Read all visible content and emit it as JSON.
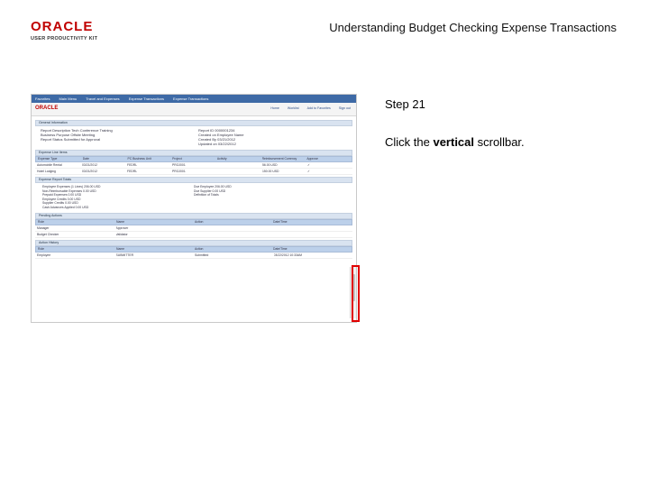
{
  "logo": {
    "primary": "ORACLE",
    "secondary": "USER PRODUCTIVITY KIT"
  },
  "header": {
    "title": "Understanding Budget Checking Expense Transactions"
  },
  "step": {
    "label": "Step 21"
  },
  "instruction": {
    "before": "Click the ",
    "bold": "vertical",
    "after": " scrollbar."
  },
  "colors": {
    "highlight": "#e00000",
    "brand_red": "#c00000",
    "nav_blue": "#3e6aa6"
  },
  "screenshot": {
    "brand": "ORACLE",
    "nav": [
      "Favorites",
      "Main Menu",
      "Travel and Expenses",
      "Expense Transactions",
      "Expense Transactions"
    ],
    "toplinks": [
      "Home",
      "Worklist",
      "Add to Favorites",
      "Sign out"
    ],
    "sections": {
      "general": "General Information",
      "lines": "Expense Line Items",
      "totals": "Expense Report Totals",
      "approvals": "Pending Actions",
      "history": "Action History"
    },
    "general_rows": [
      {
        "label": "Report Description",
        "value": "Tech Conference Training"
      },
      {
        "label": "Business Purpose",
        "value": "Offsite Meeting"
      },
      {
        "label": "Report Status",
        "value": "Submitted for Approval"
      }
    ],
    "general_rows_right": [
      {
        "label": "Report ID",
        "value": "0000001234"
      },
      {
        "label": "Created on",
        "value": "Employee Name"
      },
      {
        "label": "Created By",
        "value": "03/21/2012"
      },
      {
        "label": "Updated on",
        "value": "03/22/2012"
      }
    ],
    "line_columns": [
      "Expense Type",
      "Date",
      "PC Business Unit",
      "Project",
      "Activity",
      "Reimbursement Currency",
      "Approve"
    ],
    "line_rows": [
      [
        "Automobile Rental",
        "03/21/2012",
        "FEDRL",
        "PROJ001",
        "",
        "56.00 USD",
        "✓"
      ],
      [
        "Hotel Lodging",
        "03/21/2012",
        "FEDRL",
        "PROJ001",
        "",
        "150.00 USD",
        "✓"
      ]
    ],
    "totals_left": [
      "Employee Expenses (1 Lines) 206.00 USD",
      "Non-Reimbursable Expenses 0.00 USD",
      "Prepaid Expenses 0.00 USD",
      "Employee Credits 0.00 USD",
      "Supplier Credits 0.00 USD",
      "Cash Advances Applied 0.00 USD"
    ],
    "totals_right": [
      "Due Employee 206.00 USD",
      "Due Supplier 0.00 USD",
      "Definition of Totals"
    ],
    "pending_columns": [
      "Role",
      "Name",
      "Action",
      "Date/Time"
    ],
    "pending_rows": [
      [
        "Manager",
        "Approver"
      ],
      [
        "Budget Checker",
        "Validator"
      ]
    ],
    "history_columns": [
      "Role",
      "Name",
      "Action",
      "Date/Time"
    ],
    "history_rows": [
      [
        "Employee",
        "SUBMITTER",
        "Submitted",
        "03/22/2012 10:33AM"
      ]
    ]
  }
}
